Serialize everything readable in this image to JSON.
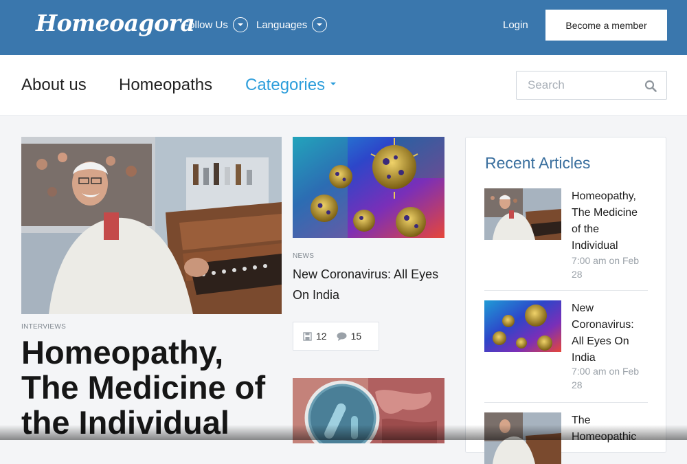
{
  "header": {
    "logo": "Homeoagora",
    "follow_us": "Follow Us",
    "languages": "Languages",
    "login": "Login",
    "become_member": "Become a member"
  },
  "nav": {
    "about": "About us",
    "homeopaths": "Homeopaths",
    "categories": "Categories",
    "search_placeholder": "Search"
  },
  "featured": {
    "category": "INTERVIEWS",
    "title": "Homeopathy, The Medicine of the Individual"
  },
  "article2": {
    "category": "NEWS",
    "title": "New Coronavirus: All Eyes On India",
    "stat1": "12",
    "stat2": "15"
  },
  "sidebar": {
    "heading": "Recent Articles",
    "items": [
      {
        "title": "Homeopathy, The Medicine of the Individual",
        "date": "7:00 am on Feb 28"
      },
      {
        "title": "New Coronavirus: All Eyes On India",
        "date": "7:00 am on Feb 28"
      },
      {
        "title": "The Homeopathic"
      }
    ]
  },
  "colors": {
    "header_bg": "#3a77ad",
    "accent": "#2e9edb",
    "sidebar_heading": "#3a6f9e"
  }
}
